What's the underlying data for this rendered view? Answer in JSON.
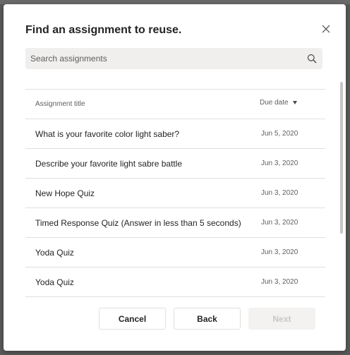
{
  "dialog": {
    "title": "Find an assignment to reuse."
  },
  "search": {
    "placeholder": "Search assignments",
    "value": ""
  },
  "table": {
    "columns": {
      "title": "Assignment title",
      "due_date": "Due date"
    },
    "sort": {
      "column": "due_date",
      "direction": "descending"
    },
    "rows": [
      {
        "title": "What is your favorite color light saber?",
        "due_date": "Jun 5, 2020"
      },
      {
        "title": "Describe your favorite light sabre battle",
        "due_date": "Jun 3, 2020"
      },
      {
        "title": "New Hope Quiz",
        "due_date": "Jun 3, 2020"
      },
      {
        "title": "Timed Response Quiz (Answer in less than 5 seconds)",
        "due_date": "Jun 3, 2020"
      },
      {
        "title": "Yoda Quiz",
        "due_date": "Jun 3, 2020"
      },
      {
        "title": "Yoda Quiz",
        "due_date": "Jun 3, 2020"
      }
    ]
  },
  "buttons": {
    "cancel": "Cancel",
    "back": "Back",
    "next": "Next"
  },
  "icons": {
    "close": "close-icon",
    "search": "search-icon",
    "sort": "sort-descending-icon"
  },
  "colors": {
    "title_text": "#252423",
    "secondary_text": "#605e5c",
    "search_bg": "#f0efee",
    "divider": "#e1dfdd",
    "disabled_button_bg": "#f3f2f1",
    "disabled_button_text": "#c8c6c4",
    "overlay": "#5a5a5a"
  }
}
